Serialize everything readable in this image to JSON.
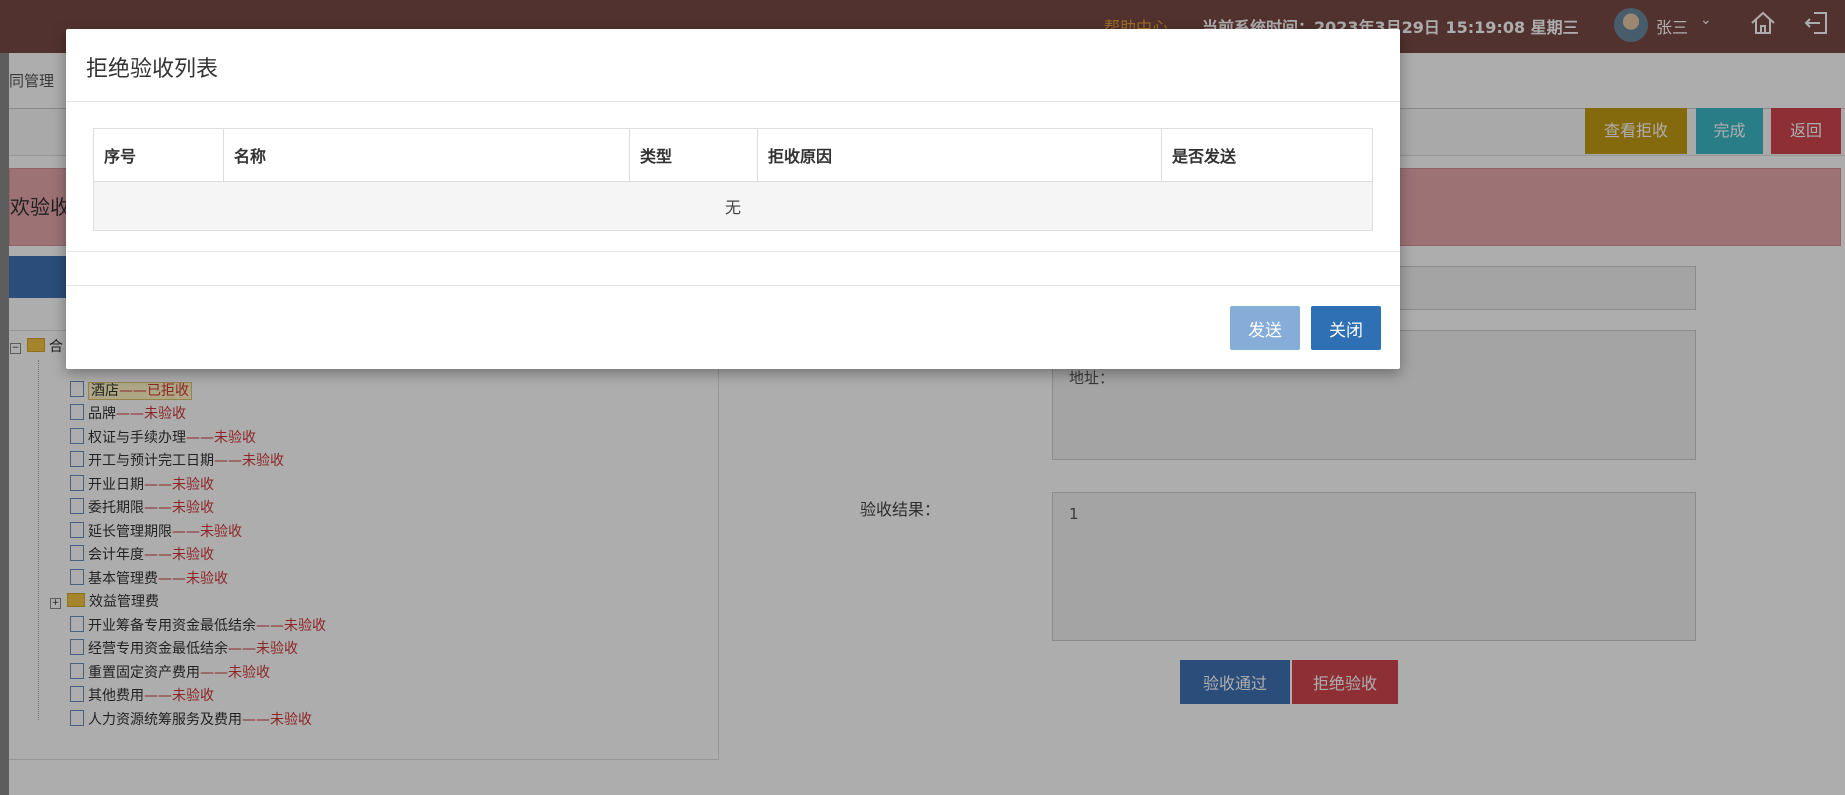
{
  "header": {
    "help_label": "帮助中心",
    "system_time_label": "当前系统时间：2023年3月29日 15:19:08 星期三",
    "user_name": "张三",
    "icons": {
      "avatar": "avatar",
      "chevron": "chevron-down-icon",
      "home": "home-icon",
      "logout": "logout-icon"
    }
  },
  "page": {
    "breadcrumb": "同管理",
    "panel_title": "欢验收",
    "toolbar": {
      "view_reject_label": "查看拒收",
      "complete_label": "完成",
      "back_label": "返回"
    },
    "colors": {
      "view_reject": "#c49d14",
      "complete": "#3bb8c6",
      "back": "#d0464f"
    }
  },
  "tree": {
    "root_label": "合",
    "items": [
      {
        "name": "酒店",
        "status": "——已拒收",
        "selected": true
      },
      {
        "name": "品牌",
        "status": "——未验收"
      },
      {
        "name": "权证与手续办理",
        "status": "——未验收"
      },
      {
        "name": "开工与预计完工日期",
        "status": "——未验收"
      },
      {
        "name": "开业日期",
        "status": "——未验收"
      },
      {
        "name": "委托期限",
        "status": "——未验收"
      },
      {
        "name": "延长管理期限",
        "status": "——未验收"
      },
      {
        "name": "会计年度",
        "status": "——未验收"
      },
      {
        "name": "基本管理费",
        "status": "——未验收"
      }
    ],
    "folder_item": "效益管理费",
    "items_after": [
      {
        "name": "开业筹备专用资金最低结余",
        "status": "——未验收"
      },
      {
        "name": "经营专用资金最低结余",
        "status": "——未验收"
      },
      {
        "name": "重置固定资产费用",
        "status": "——未验收"
      },
      {
        "name": "其他费用",
        "status": "——未验收"
      },
      {
        "name": "人力资源统筹服务及费用",
        "status": "——未验收"
      }
    ]
  },
  "form": {
    "address_label": "地址：",
    "result_label": "验收结果：",
    "result_value": "1",
    "pass_label": "验收通过",
    "reject_label": "拒绝验收"
  },
  "modal": {
    "title": "拒绝验收列表",
    "columns": [
      "序号",
      "名称",
      "类型",
      "拒收原因",
      "是否发送"
    ],
    "empty_text": "无",
    "send_label": "发送",
    "close_label": "关闭"
  }
}
